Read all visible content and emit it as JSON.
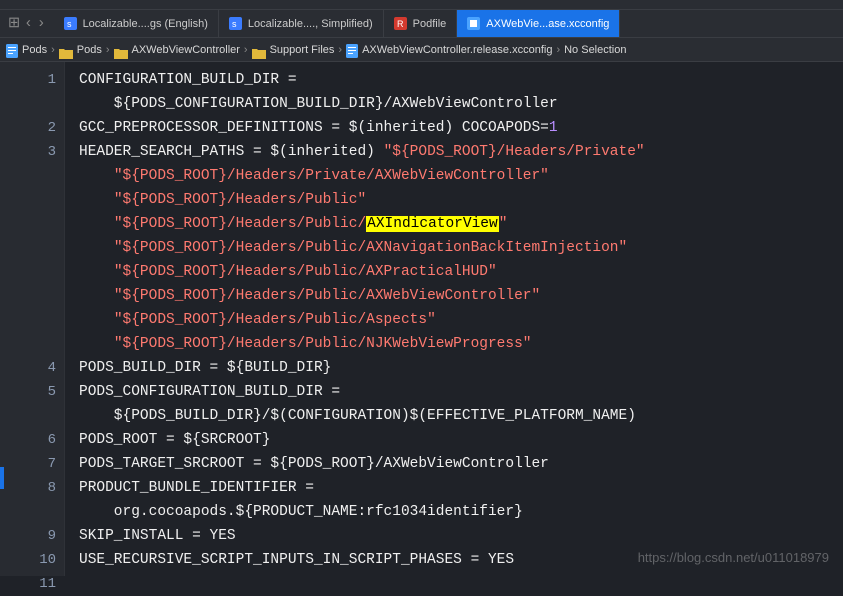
{
  "tabs": [
    {
      "label": "Localizable....gs (English)",
      "type": "strings"
    },
    {
      "label": "Localizable...., Simplified)",
      "type": "strings"
    },
    {
      "label": "Podfile",
      "type": "ruby"
    },
    {
      "label": "AXWebVie...ase.xcconfig",
      "type": "xcconfig",
      "active": true
    }
  ],
  "breadcrumb": [
    {
      "label": "Pods",
      "icon": "file"
    },
    {
      "label": "Pods",
      "icon": "folder"
    },
    {
      "label": "AXWebViewController",
      "icon": "folder"
    },
    {
      "label": "Support Files",
      "icon": "folder"
    },
    {
      "label": "AXWebViewController.release.xcconfig",
      "icon": "file"
    },
    {
      "label": "No Selection",
      "icon": "none"
    }
  ],
  "code": {
    "lines": [
      {
        "n": "1",
        "t": "CONFIGURATION_BUILD_DIR ="
      },
      {
        "n": "",
        "t": "    ${PODS_CONFIGURATION_BUILD_DIR}/AXWebViewController"
      },
      {
        "n": "2",
        "t_segs": [
          [
            "kw",
            "GCC_PREPROCESSOR_DEFINITIONS = $(inherited) COCOAPODS="
          ],
          [
            "num",
            "1"
          ]
        ]
      },
      {
        "n": "3",
        "t_segs": [
          [
            "kw",
            "HEADER_SEARCH_PATHS = $(inherited) "
          ],
          [
            "str",
            "\"${PODS_ROOT}/Headers/Private\""
          ]
        ]
      },
      {
        "n": "",
        "t_segs": [
          [
            "kw",
            "    "
          ],
          [
            "str",
            "\"${PODS_ROOT}/Headers/Private/AXWebViewController\""
          ]
        ]
      },
      {
        "n": "",
        "t_segs": [
          [
            "kw",
            "    "
          ],
          [
            "str",
            "\"${PODS_ROOT}/Headers/Public\""
          ]
        ]
      },
      {
        "n": "",
        "t_segs": [
          [
            "kw",
            "    "
          ],
          [
            "str",
            "\"${PODS_ROOT}/Headers/Public/"
          ],
          [
            "hl",
            "AXIndicatorView"
          ],
          [
            "str",
            "\""
          ]
        ]
      },
      {
        "n": "",
        "t_segs": [
          [
            "kw",
            "    "
          ],
          [
            "str",
            "\"${PODS_ROOT}/Headers/Public/AXNavigationBackItemInjection\""
          ]
        ]
      },
      {
        "n": "",
        "t_segs": [
          [
            "kw",
            "    "
          ],
          [
            "str",
            "\"${PODS_ROOT}/Headers/Public/AXPracticalHUD\""
          ]
        ]
      },
      {
        "n": "",
        "t_segs": [
          [
            "kw",
            "    "
          ],
          [
            "str",
            "\"${PODS_ROOT}/Headers/Public/AXWebViewController\""
          ]
        ]
      },
      {
        "n": "",
        "t_segs": [
          [
            "kw",
            "    "
          ],
          [
            "str",
            "\"${PODS_ROOT}/Headers/Public/Aspects\""
          ]
        ]
      },
      {
        "n": "",
        "t_segs": [
          [
            "kw",
            "    "
          ],
          [
            "str",
            "\"${PODS_ROOT}/Headers/Public/NJKWebViewProgress\""
          ]
        ]
      },
      {
        "n": "4",
        "t": "PODS_BUILD_DIR = ${BUILD_DIR}"
      },
      {
        "n": "5",
        "t": "PODS_CONFIGURATION_BUILD_DIR ="
      },
      {
        "n": "",
        "t": "    ${PODS_BUILD_DIR}/$(CONFIGURATION)$(EFFECTIVE_PLATFORM_NAME)"
      },
      {
        "n": "6",
        "t": "PODS_ROOT = ${SRCROOT}"
      },
      {
        "n": "7",
        "t": "PODS_TARGET_SRCROOT = ${PODS_ROOT}/AXWebViewController"
      },
      {
        "n": "8",
        "t": "PRODUCT_BUNDLE_IDENTIFIER ="
      },
      {
        "n": "",
        "t": "    org.cocoapods.${PRODUCT_NAME:rfc1034identifier}"
      },
      {
        "n": "9",
        "t": "SKIP_INSTALL = YES"
      },
      {
        "n": "10",
        "t": "USE_RECURSIVE_SCRIPT_INPUTS_IN_SCRIPT_PHASES = YES"
      },
      {
        "n": "11",
        "t": ""
      }
    ]
  },
  "watermark": "https://blog.csdn.net/u011018979",
  "icons": {
    "grid": "⊞",
    "back": "‹",
    "fwd": "›"
  }
}
